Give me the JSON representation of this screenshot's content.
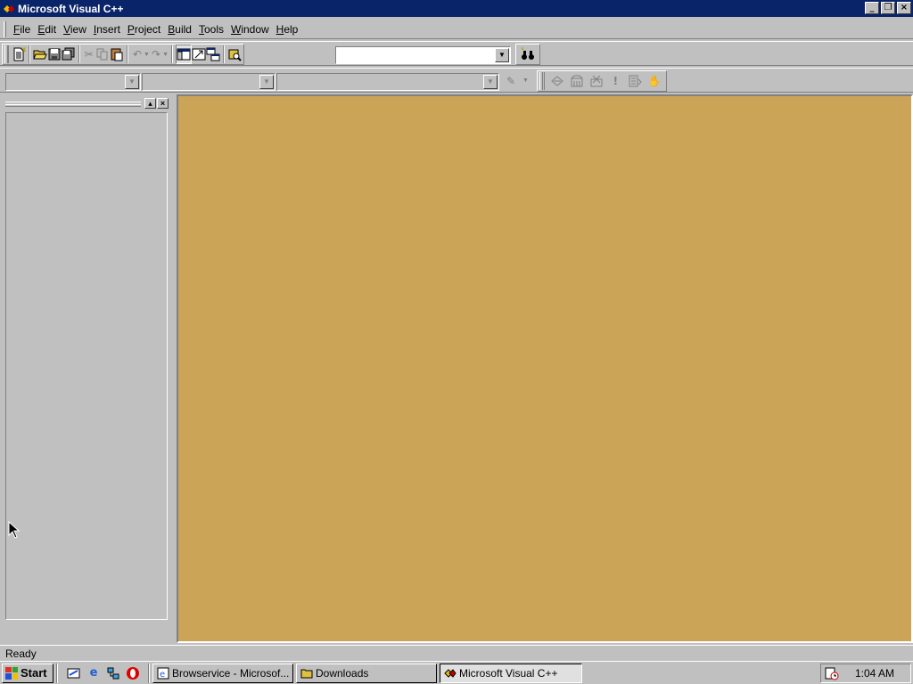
{
  "window": {
    "title": "Microsoft Visual C++"
  },
  "menu": [
    {
      "label": "File",
      "accel": "F",
      "rest": "ile"
    },
    {
      "label": "Edit",
      "accel": "E",
      "rest": "dit"
    },
    {
      "label": "View",
      "accel": "V",
      "rest": "iew"
    },
    {
      "label": "Insert",
      "accel": "I",
      "rest": "nsert"
    },
    {
      "label": "Project",
      "accel": "P",
      "rest": "roject"
    },
    {
      "label": "Build",
      "accel": "B",
      "rest": "uild"
    },
    {
      "label": "Tools",
      "accel": "T",
      "rest": "ools"
    },
    {
      "label": "Window",
      "accel": "W",
      "rest": "indow"
    },
    {
      "label": "Help",
      "accel": "H",
      "rest": "elp"
    }
  ],
  "toolbar": {
    "find_combo_value": ""
  },
  "wizardbar": {
    "class_combo": "",
    "filter_combo": "",
    "members_combo": ""
  },
  "status": {
    "text": "Ready"
  },
  "taskbar": {
    "start_label": "Start",
    "tasks": [
      {
        "label": "Browservice - Microsof...",
        "active": false
      },
      {
        "label": "Downloads",
        "active": false
      },
      {
        "label": "Microsoft Visual C++",
        "active": true
      }
    ],
    "clock": "1:04 AM"
  },
  "colors": {
    "titlebar": "#0a246a",
    "desktop_mdi": "#cca457",
    "face": "#c0c0c0"
  }
}
